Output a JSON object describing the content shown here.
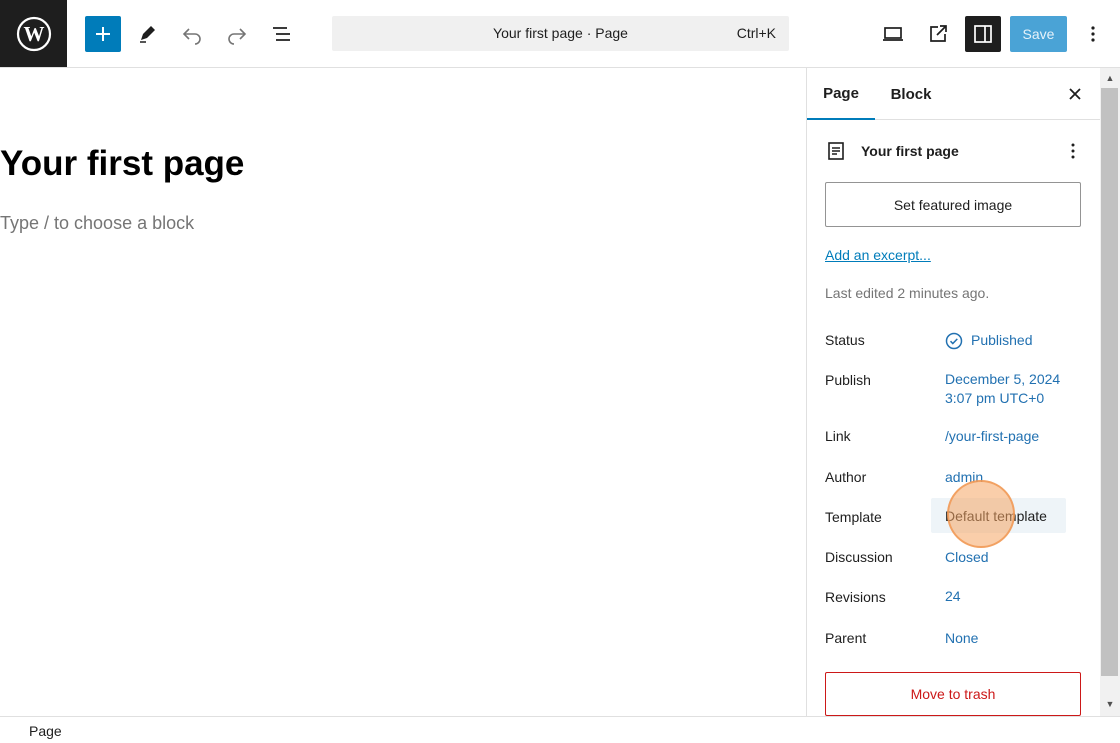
{
  "toolbar": {
    "wp_logo": "wordpress-icon",
    "add_block_icon": "plus-icon",
    "tools_icon": "pencil-icon",
    "undo_icon": "undo-icon",
    "redo_icon": "redo-icon",
    "document_overview_icon": "list-view-icon",
    "command_palette": {
      "title": "Your first page · Page",
      "shortcut": "Ctrl+K"
    },
    "preview_icon": "desktop-icon",
    "view_page_icon": "external-icon",
    "settings_icon": "sidebar-icon",
    "save_label": "Save",
    "options_icon": "more-vertical-icon",
    "accent_color": "#007cba"
  },
  "editor": {
    "title": "Your first page",
    "placeholder": "Type / to choose a block"
  },
  "sidebar": {
    "tabs": [
      "Page",
      "Block"
    ],
    "active_tab": "Page",
    "close_icon": "close-icon",
    "post_title": "Your first page",
    "featured_image_label": "Set featured image",
    "excerpt_link": "Add an excerpt...",
    "last_edited": "Last edited 2 minutes ago.",
    "rows": {
      "status": {
        "label": "Status",
        "value": "Published"
      },
      "publish": {
        "label": "Publish",
        "value_line1": "December 5, 2024",
        "value_line2": "3:07 pm UTC+0"
      },
      "link": {
        "label": "Link",
        "value": "/your-first-page"
      },
      "author": {
        "label": "Author",
        "value": "admin"
      },
      "template": {
        "label": "Template",
        "value": "Default template"
      },
      "discussion": {
        "label": "Discussion",
        "value": "Closed"
      },
      "revisions": {
        "label": "Revisions",
        "value": "24"
      },
      "parent": {
        "label": "Parent",
        "value": "None"
      }
    },
    "trash_label": "Move to trash"
  },
  "footer": {
    "breadcrumb": "Page"
  }
}
